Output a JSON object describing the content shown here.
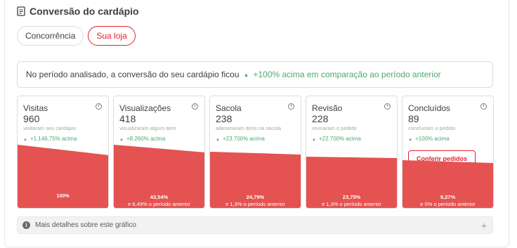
{
  "header": {
    "title": "Conversão do cardápio",
    "icon": "document-icon"
  },
  "tabs": [
    {
      "label": "Concorrência",
      "active": false
    },
    {
      "label": "Sua loja",
      "active": true
    }
  ],
  "summary": {
    "text": "No período analisado, a conversão do seu cardápio ficou",
    "highlight": "+100% acima em comparação ao período anterior"
  },
  "funnel": [
    {
      "name": "Visitas",
      "value": "960",
      "sub": "visitaram seu cardápio",
      "delta": "+1.146,75% acima",
      "pct": "100%",
      "cmp": "",
      "level": 1.0
    },
    {
      "name": "Visualizações",
      "value": "418",
      "sub": "visualizaram algum item",
      "delta": "+8.260% acima",
      "pct": "43,54%",
      "cmp": "e 6,49% o período anterior",
      "level": 0.4354
    },
    {
      "name": "Sacola",
      "value": "238",
      "sub": "adicionaram itens na sacola",
      "delta": "+23.700% acima",
      "pct": "24,79%",
      "cmp": "e 1,3% o período anterior",
      "level": 0.2479
    },
    {
      "name": "Revisão",
      "value": "228",
      "sub": "revisaram o pedido",
      "delta": "+22.700% acima",
      "pct": "23,75%",
      "cmp": "e 1,3% o período anterior",
      "level": 0.2375
    },
    {
      "name": "Concluídos",
      "value": "89",
      "sub": "concluiram o pedido",
      "delta": "+100% acima",
      "pct": "9,27%",
      "cmp": "e 0% o período anterior",
      "level": 0.0927,
      "cta": "Conferir pedidos"
    }
  ],
  "details": {
    "label": "Mais detalhes sobre este gráfico"
  },
  "colors": {
    "accent": "#ea1d2c",
    "bar": "#e45252",
    "positive": "#50a773"
  }
}
